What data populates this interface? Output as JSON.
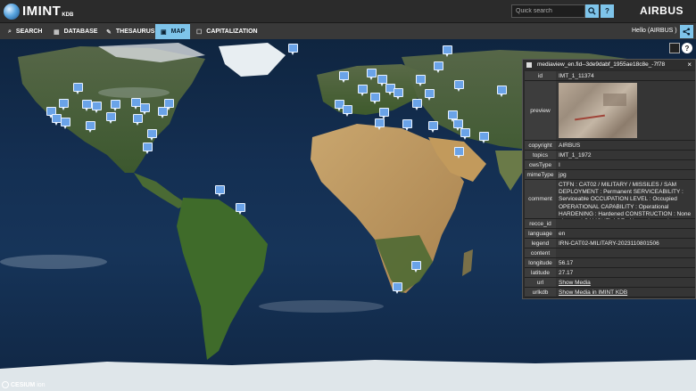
{
  "header": {
    "logo_text": "IMINT",
    "logo_sub": "KDB",
    "search_placeholder": "Quick search",
    "search_icon": "search-icon",
    "help_label": "?",
    "brand": "AIRBUS"
  },
  "nav": {
    "tabs": [
      {
        "label": "SEARCH",
        "icon": "search-icon",
        "glyph": "⌕"
      },
      {
        "label": "DATABASE",
        "icon": "database-icon",
        "glyph": "▦"
      },
      {
        "label": "THESAURUS",
        "icon": "tag-icon",
        "glyph": "✎"
      },
      {
        "label": "MAP",
        "icon": "map-icon",
        "glyph": "▣"
      },
      {
        "label": "CAPITALIZATION",
        "icon": "checkbox-icon",
        "glyph": "☐"
      }
    ],
    "active_tab": "MAP",
    "hello": "Hello  (AIRBUS )",
    "share_icon": "share-icon"
  },
  "map": {
    "help_label": "?",
    "attribution": "CESIUM",
    "attribution_sub": "ion"
  },
  "panel": {
    "title": "mediaview_en.fid--3de9dabf_1955ae18c8e_-7f78",
    "close": "×",
    "rows": {
      "id": {
        "label": "id",
        "value": "IMT_1_11374"
      },
      "preview": {
        "label": "preview"
      },
      "copyright": {
        "label": "copyright",
        "value": "AIRBUS"
      },
      "topics": {
        "label": "topics",
        "value": "IMT_1_1972"
      },
      "cwsType": {
        "label": "cwsType",
        "value": "I"
      },
      "mimeType": {
        "label": "mimeType",
        "value": "jpg"
      },
      "comment": {
        "label": "comment",
        "value": "CTFN : CAT02 / MILITARY / MISSILES / SAM DEPLOYMENT : Permanent SERVICEABILITY : Serviceable OCCUPATION LEVEL : Occupied OPERATIONAL CAPABILITY : Operational HARDENING : Hardened CONSTRUCTION : None observed CAMOUFLAGE : None observed"
      },
      "recce_id": {
        "label": "recce_id",
        "value": ""
      },
      "language": {
        "label": "language",
        "value": "en"
      },
      "legend": {
        "label": "legend",
        "value": "IRN-CAT02-MILITARY-2023110801506"
      },
      "content": {
        "label": "content",
        "value": ""
      },
      "longitude": {
        "label": "longitude",
        "value": "56.17"
      },
      "latitude": {
        "label": "latitude",
        "value": "27.17"
      },
      "url": {
        "label": "url",
        "value": "Show Media"
      },
      "urlkdb": {
        "label": "urlkdb",
        "value": "Show Media in IMINT KDB"
      }
    }
  }
}
